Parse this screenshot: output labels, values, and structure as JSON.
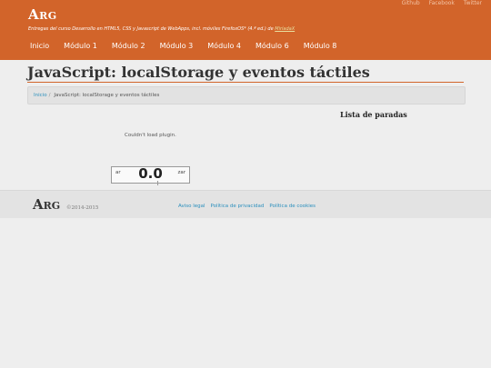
{
  "header": {
    "brand": "Arg",
    "top_links": [
      "Github",
      "Facebook",
      "Twitter"
    ],
    "tagline_text": "Entregas del curso Desarrollo en HTML5, CSS y Javascript de WebApps, incl. móviles FirefoxOS* (4.ª ed.) de",
    "tagline_link": "MiríadaX",
    "nav": [
      "Inicio",
      "Módulo 1",
      "Módulo 2",
      "Módulo 3",
      "Módulo 4",
      "Módulo 6",
      "Módulo 8"
    ]
  },
  "page": {
    "title": "JavaScript: localStorage y eventos táctiles",
    "breadcrumb": {
      "home": "Inicio",
      "separator": "/",
      "current": "JavaScript: localStorage y eventos táctiles"
    },
    "plugin_message": "Couldn't load plugin.",
    "control": {
      "left_label": "ar",
      "value": "0.0",
      "right_label": "zar"
    },
    "stops_title": "Lista de paradas"
  },
  "footer": {
    "brand": "Arg",
    "copyright": "©2014-2015",
    "links": [
      "Aviso legal",
      "Política de privacidad",
      "Política de cookies"
    ]
  },
  "colors": {
    "header_bg": "#d2642a",
    "link": "#2a8fbd"
  }
}
